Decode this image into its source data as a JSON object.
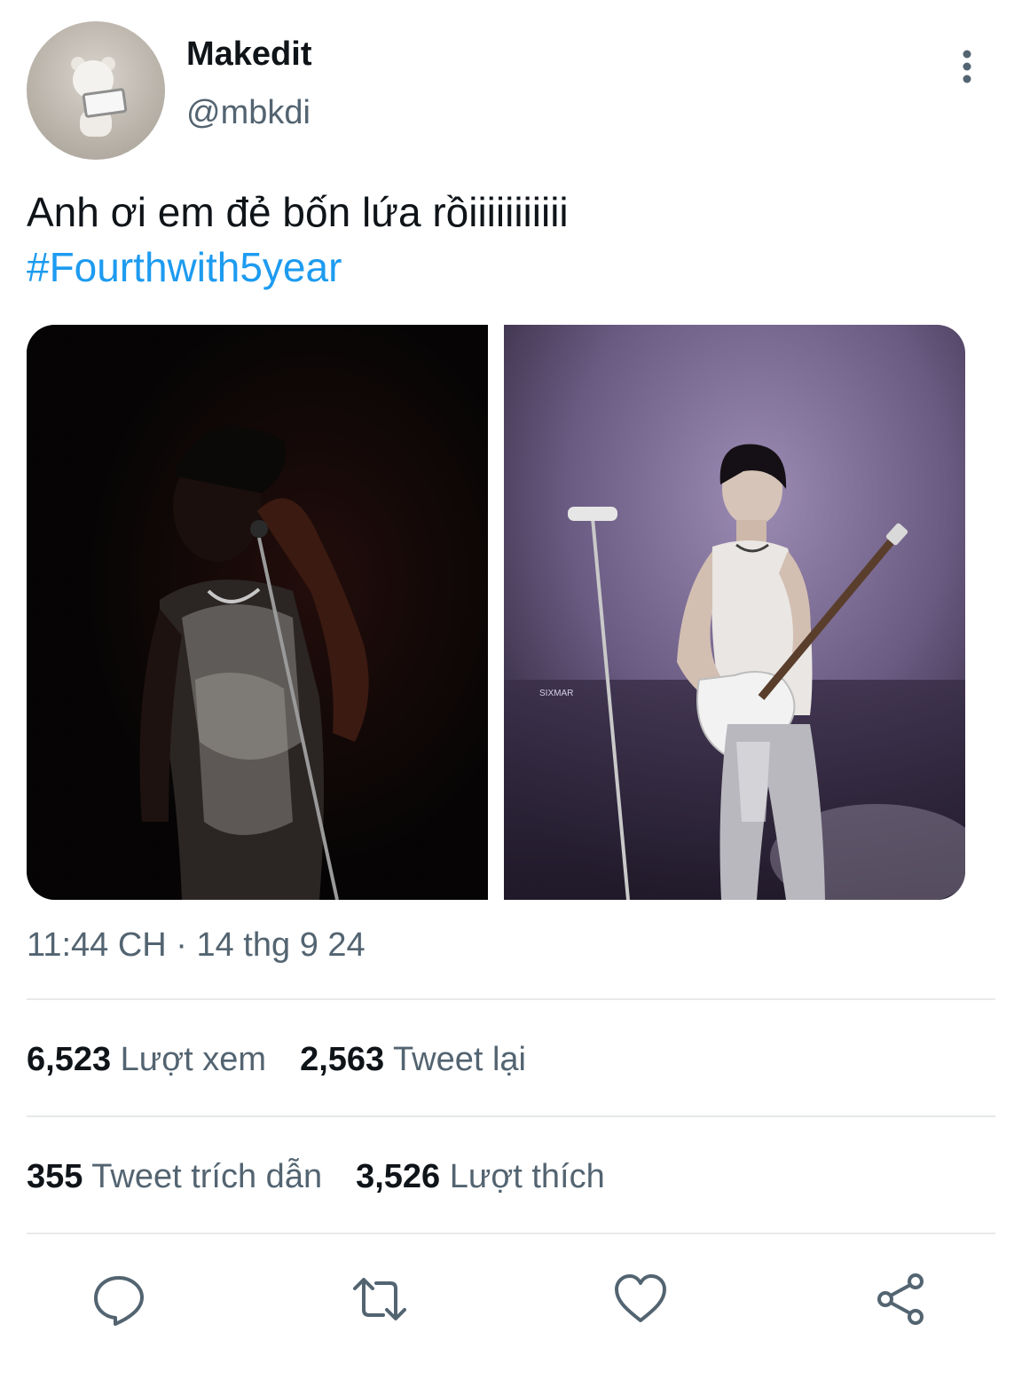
{
  "user": {
    "display_name": "Makedit",
    "handle": "@mbkdi",
    "avatar_icon": "avatar-dog-image"
  },
  "tweet": {
    "text": "Anh ơi em đẻ bốn lứa rồiiiiiiiiiii",
    "hashtag": "#Fourthwith5year",
    "timestamp": "11:44 CH · 14 thg 9 24",
    "images": [
      {
        "watermark": ""
      },
      {
        "watermark": "SIXMAR"
      }
    ]
  },
  "stats": {
    "views_count": "6,523",
    "views_label": "Lượt xem",
    "retweets_count": "2,563",
    "retweets_label": "Tweet lại",
    "quotes_count": "355",
    "quotes_label": "Tweet trích dẫn",
    "likes_count": "3,526",
    "likes_label": "Lượt thích"
  },
  "actions": {
    "icons": [
      "reply-icon",
      "retweet-icon",
      "like-icon",
      "share-icon"
    ]
  },
  "colors": {
    "link": "#1d9bf0",
    "secondary_text": "#536471",
    "divider": "#e7e9ea"
  }
}
